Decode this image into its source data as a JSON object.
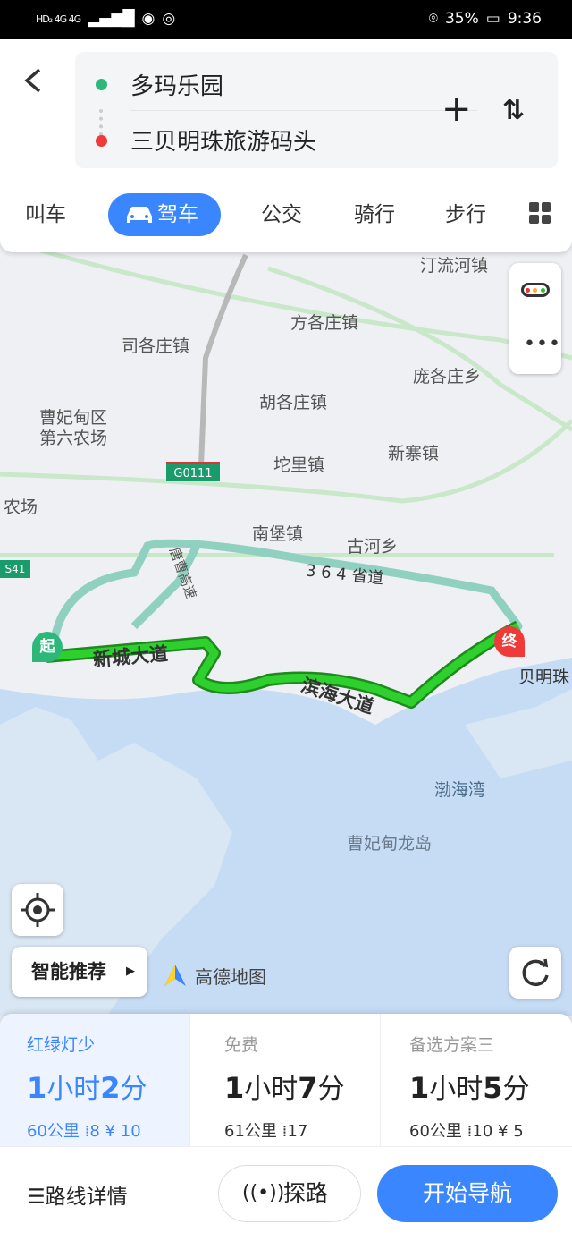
{
  "status_bar": {
    "left_icons": "HD₂ 4G 4G",
    "battery": "35%",
    "time": "9:36"
  },
  "route": {
    "origin": "多玛乐园",
    "destination": "三贝明珠旅游码头"
  },
  "tabs": [
    {
      "label": "叫车"
    },
    {
      "label": "驾车"
    },
    {
      "label": "公交"
    },
    {
      "label": "骑行"
    },
    {
      "label": "步行"
    }
  ],
  "map": {
    "labels": {
      "l1": "汀流河镇",
      "l2": "方各庄镇",
      "l3": "司各庄镇",
      "l4": "庞各庄乡",
      "l5": "曹妃甸区",
      "l6": "第六农场",
      "l7": "胡各庄镇",
      "l8": "新寨镇",
      "l9": "坨里镇",
      "l10": "农场",
      "l11": "南堡镇",
      "l12": "古河乡",
      "l13": "渤海湾",
      "l14": "曹妃甸龙岛",
      "l15": "贝明珠",
      "l16": "唐曹高速"
    },
    "shields": {
      "g0111": "G0111",
      "s41": "S41"
    },
    "roads": {
      "xincheng": "新城大道",
      "binhai": "滨海大道",
      "s364": "3 6 4 省道"
    },
    "markers": {
      "start": "起",
      "end": "终"
    },
    "smart_recommend": "智能推荐",
    "brand": "高德地图"
  },
  "routes": [
    {
      "tag": "红绿灯少",
      "hours": "1",
      "minutes": "2",
      "distance": "60公里",
      "lights": "8",
      "toll": "¥ 10",
      "selected": true
    },
    {
      "tag": "免费",
      "hours": "1",
      "minutes": "7",
      "distance": "61公里",
      "lights": "17",
      "toll": "",
      "selected": false
    },
    {
      "tag": "备选方案三",
      "hours": "1",
      "minutes": "5",
      "distance": "60公里",
      "lights": "10",
      "toll": "¥ 5",
      "selected": false
    }
  ],
  "bottom": {
    "details": "路线详情",
    "explore": "探路",
    "navigate": "开始导航"
  },
  "colors": {
    "accent": "#3a86ff",
    "route_green": "#1fbf1f",
    "alt_route": "#8fd0c0",
    "destination": "#f03a3a",
    "origin": "#2db87a"
  }
}
